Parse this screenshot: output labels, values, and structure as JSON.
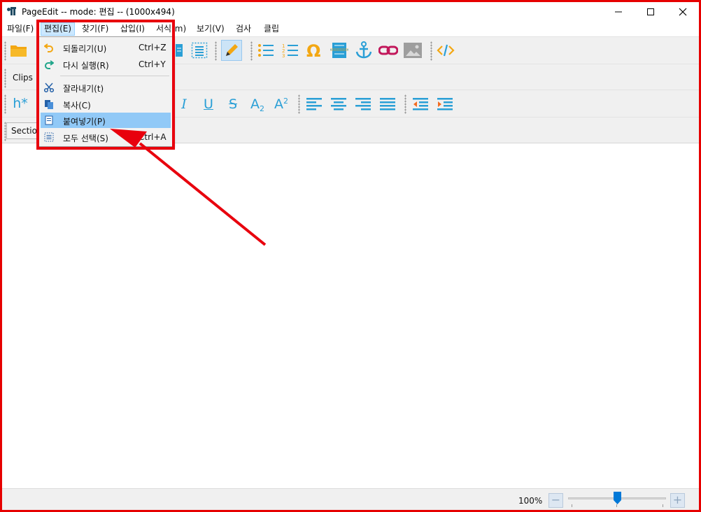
{
  "window": {
    "title": "PageEdit -- mode: 편집 -- (1000x494)",
    "app_icon": "pageedit-logo-icon",
    "controls": [
      "minimize-icon",
      "maximize-icon",
      "close-icon"
    ]
  },
  "menubar": {
    "items": [
      {
        "label": "파일(F)",
        "active": false
      },
      {
        "label": "편집(E)",
        "active": true
      },
      {
        "label": "찾기(F)",
        "active": false
      },
      {
        "label": "삽입(I)",
        "active": false
      },
      {
        "label": "서식(m)",
        "active": false
      },
      {
        "label": "보기(V)",
        "active": false
      },
      {
        "label": "검사",
        "active": false
      },
      {
        "label": "클립",
        "active": false
      }
    ]
  },
  "toolbar_clips": {
    "label": "Clips"
  },
  "toolbar_format": {
    "heading_label": "h*",
    "italic": "I",
    "underline": "U",
    "strike": "S",
    "subscript": "A",
    "subscript_mark": "2",
    "superscript": "A",
    "superscript_mark": "2"
  },
  "toolbar_section": {
    "label": "Section"
  },
  "edit_menu": {
    "items": [
      {
        "icon": "undo-icon",
        "label": "되돌리기(U)",
        "shortcut": "Ctrl+Z"
      },
      {
        "icon": "redo-icon",
        "label": "다시 실행(R)",
        "shortcut": "Ctrl+Y"
      },
      {
        "icon": "scissors-icon",
        "label": "잘라내기(t)",
        "shortcut": ""
      },
      {
        "icon": "copy-icon",
        "label": "복사(C)",
        "shortcut": ""
      },
      {
        "icon": "paste-icon",
        "label": "붙여넣기(P)",
        "shortcut": "",
        "highlighted": true
      },
      {
        "icon": "select-all-icon",
        "label": "모두 선택(S)",
        "shortcut": "Ctrl+A"
      }
    ]
  },
  "statusbar": {
    "zoom": "100%",
    "zoom_minus": "−",
    "zoom_plus": "+",
    "zoom_level": 0.5
  },
  "colors": {
    "accent": "#2a9fd6",
    "highlight": "#e8000d",
    "menu_highlight": "#91c9f7"
  }
}
